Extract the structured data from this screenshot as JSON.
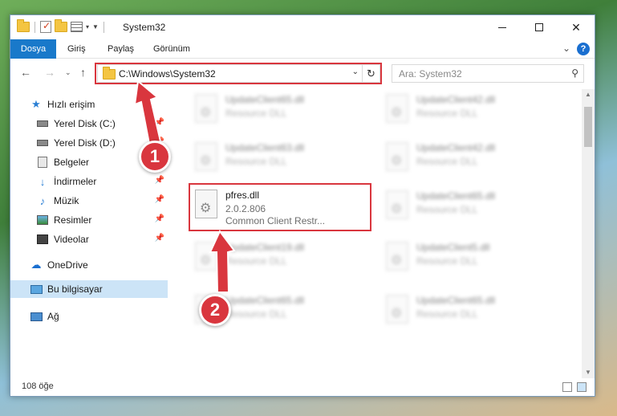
{
  "window": {
    "title": "System32",
    "controls": {
      "minimize": "—",
      "maximize": "☐",
      "close": "✕"
    }
  },
  "ribbon": {
    "tabs": [
      "Dosya",
      "Giriş",
      "Paylaş",
      "Görünüm"
    ],
    "help": "?"
  },
  "navbar": {
    "address": "C:\\Windows\\System32",
    "search_placeholder": "Ara: System32"
  },
  "sidebar": {
    "items": [
      {
        "label": "Hızlı erişim",
        "icon": "star-icon"
      },
      {
        "label": "Yerel Disk (C:)",
        "icon": "disk-icon",
        "pinned": true
      },
      {
        "label": "Yerel Disk (D:)",
        "icon": "disk-icon",
        "pinned": true
      },
      {
        "label": "Belgeler",
        "icon": "documents-icon",
        "pinned": true
      },
      {
        "label": "İndirmeler",
        "icon": "download-icon",
        "pinned": true
      },
      {
        "label": "Müzik",
        "icon": "music-icon",
        "pinned": true
      },
      {
        "label": "Resimler",
        "icon": "pictures-icon",
        "pinned": true
      },
      {
        "label": "Videolar",
        "icon": "videos-icon",
        "pinned": true
      },
      {
        "label": "OneDrive",
        "icon": "cloud-icon"
      },
      {
        "label": "Bu bilgisayar",
        "icon": "computer-icon",
        "selected": true
      },
      {
        "label": "Ağ",
        "icon": "network-icon"
      }
    ]
  },
  "files": [
    {
      "name": "UpdateClient65.dll",
      "desc": "Resource DLL"
    },
    {
      "name": "UpdateClient42.dll",
      "desc": "Resource DLL"
    },
    {
      "name": "UpdateClient63.dll",
      "desc": "Resource DLL"
    },
    {
      "name": "UpdateClient42.dll",
      "desc": "Resource DLL"
    },
    {
      "name": "pfres.dll",
      "version": "2.0.2.806",
      "desc": "Common Client Restr..."
    },
    {
      "name": "UpdateClient65.dll",
      "desc": "Resource DLL"
    },
    {
      "name": "UpdateClient19.dll",
      "desc": "Resource DLL"
    },
    {
      "name": "UpdateClient5.dll",
      "desc": "Resource DLL"
    },
    {
      "name": "UpdateClient65.dll",
      "desc": "Resource DLL"
    },
    {
      "name": "UpdateClient65.dll",
      "desc": "Resource DLL"
    }
  ],
  "status": {
    "count": "108 öğe"
  },
  "annotations": {
    "step1": "1",
    "step2": "2"
  },
  "colors": {
    "accent": "#1979ca",
    "highlight": "#d9363e",
    "selection": "#cce4f7"
  }
}
